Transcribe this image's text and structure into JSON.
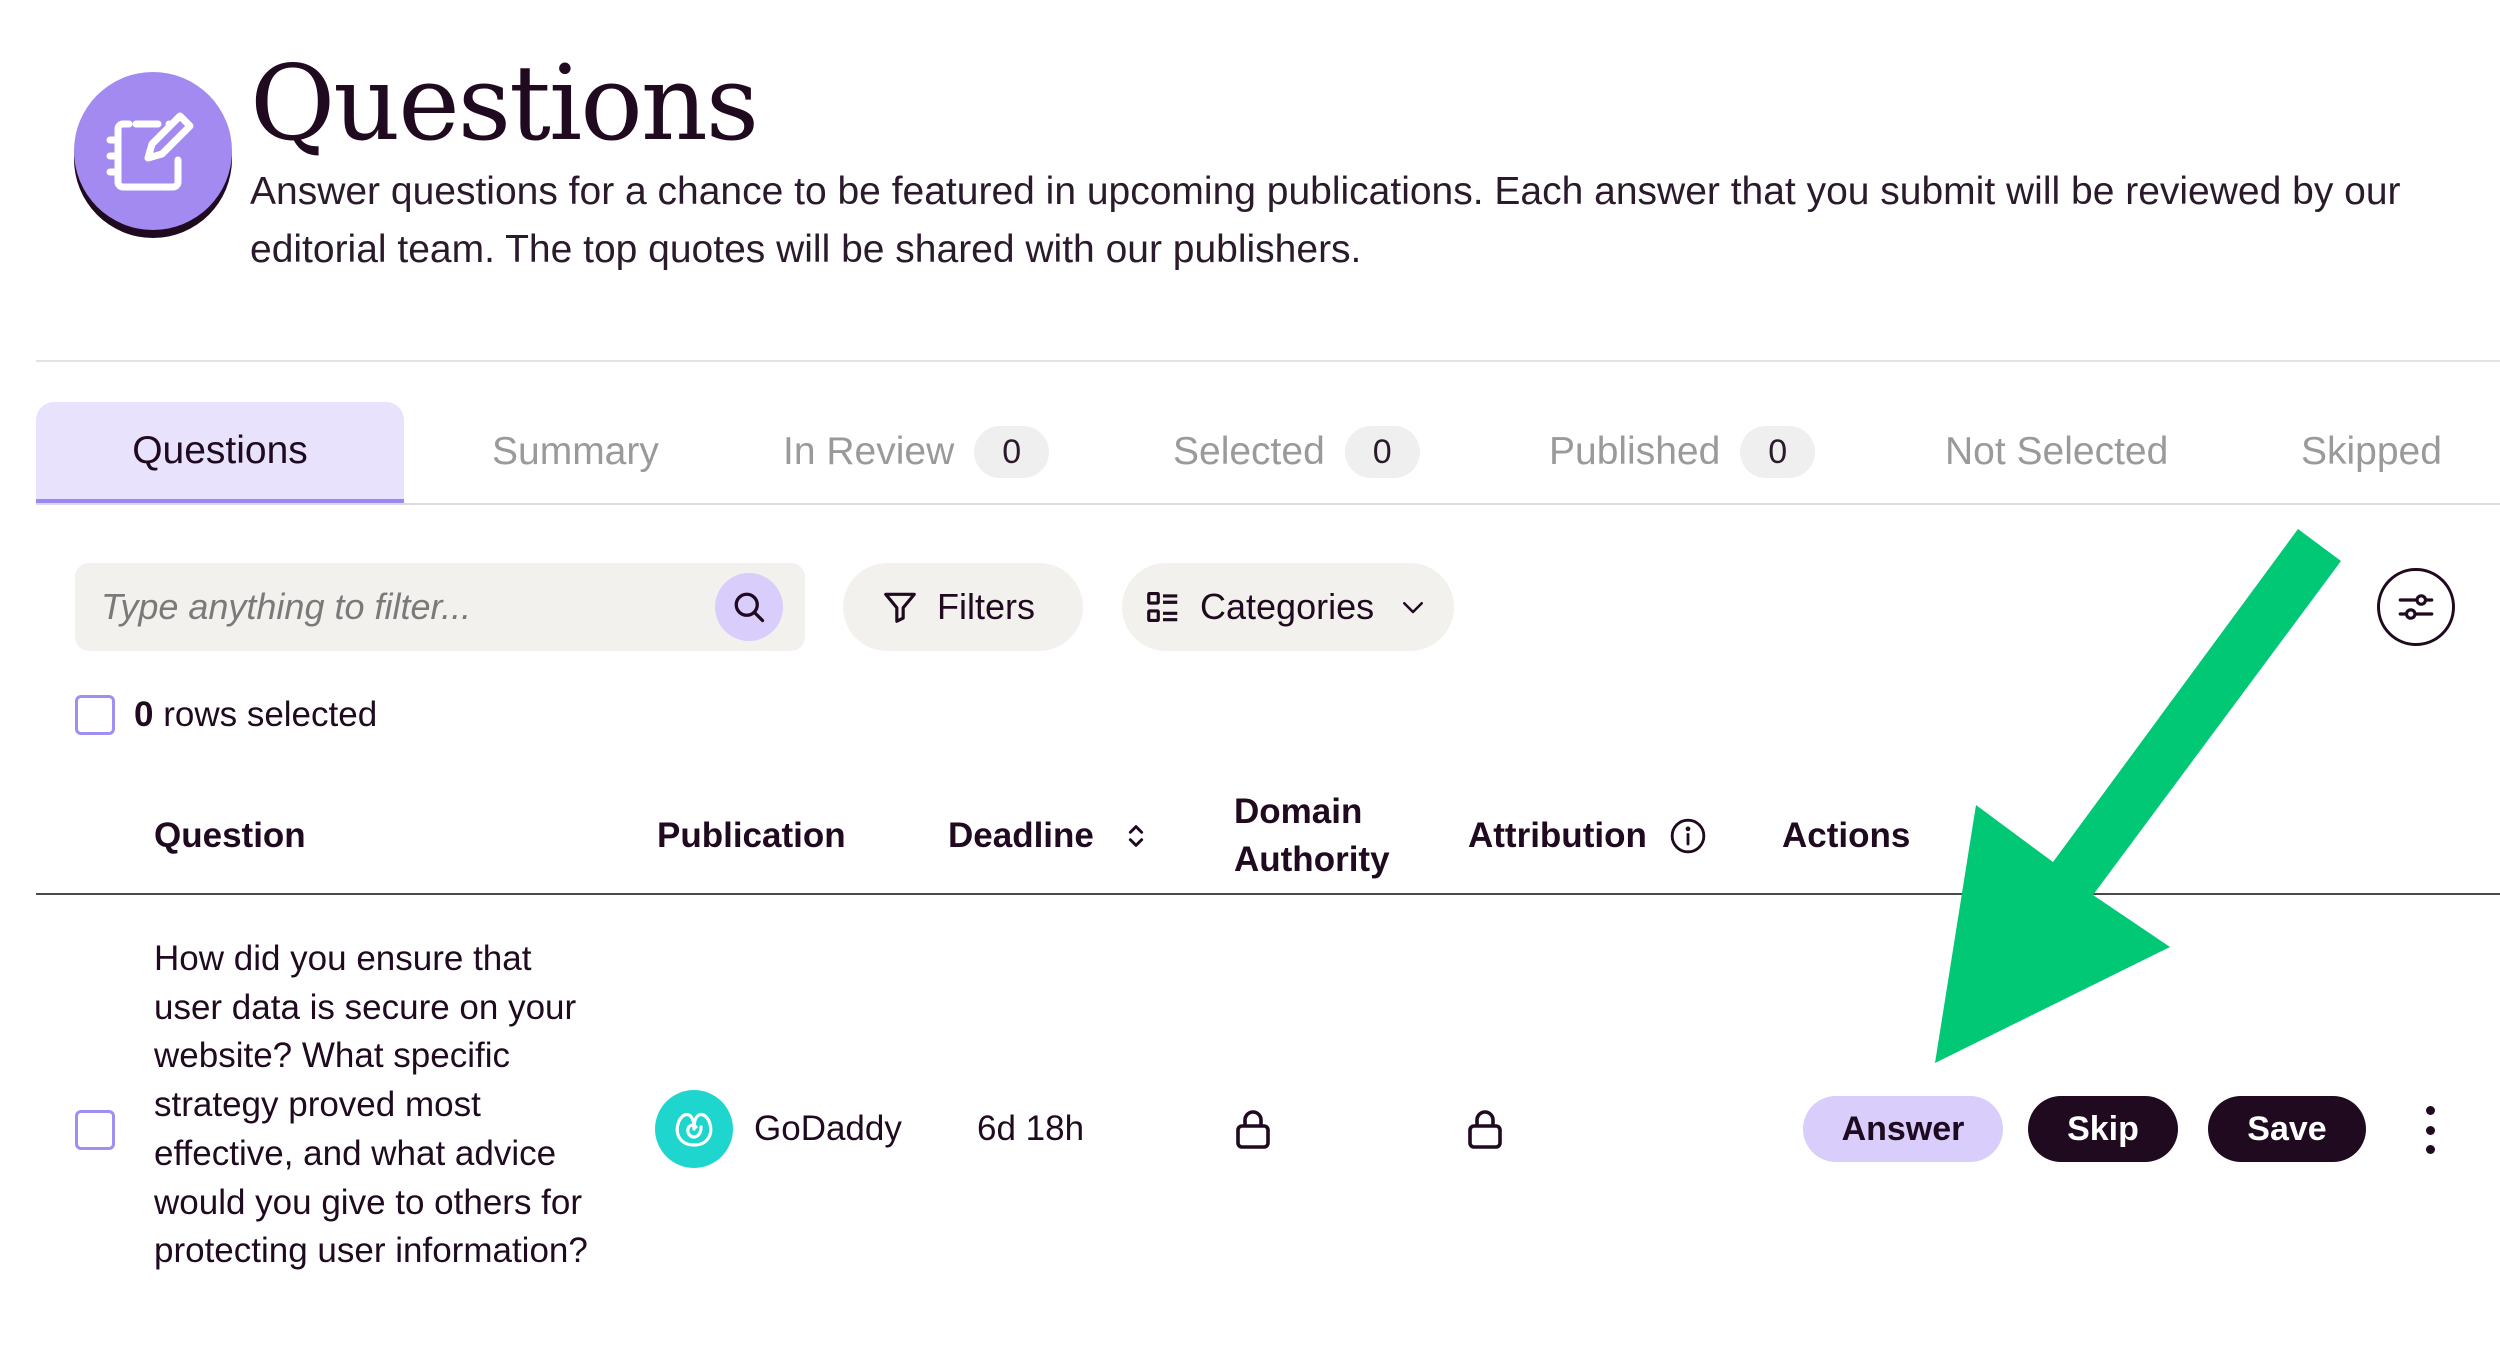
{
  "header": {
    "title": "Questions",
    "description": "Answer questions for a chance to be featured in upcoming publications. Each answer that you submit will be reviewed by our editorial  team. The top quotes will be shared with our publishers.",
    "icon": "notebook-pencil-icon"
  },
  "tabs": [
    {
      "label": "Questions",
      "active": true
    },
    {
      "label": "Summary"
    },
    {
      "label": "In Review",
      "count": "0"
    },
    {
      "label": "Selected",
      "count": "0"
    },
    {
      "label": "Published",
      "count": "0"
    },
    {
      "label": "Not Selected"
    },
    {
      "label": "Skipped"
    }
  ],
  "toolbar": {
    "search_placeholder": "Type anything to filter...",
    "filters_label": "Filters",
    "categories_label": "Categories"
  },
  "selection": {
    "count": "0",
    "label": " rows selected"
  },
  "table": {
    "columns": {
      "question": "Question",
      "publication": "Publication",
      "deadline": "Deadline",
      "domain_authority_1": "Domain",
      "domain_authority_2": "Authority",
      "attribution": "Attribution",
      "actions": "Actions"
    },
    "rows": [
      {
        "question": "How did you ensure that user data is secure on your website? What specific strategy proved most effective, and what advice would you give to others for protecting user information?",
        "publication": "GoDaddy",
        "deadline": "6d 18h",
        "domain_authority": "locked",
        "attribution": "locked",
        "actions": {
          "answer": "Answer",
          "skip": "Skip",
          "save": "Save"
        }
      }
    ]
  },
  "colors": {
    "accent_purple": "#a18ef3",
    "active_tab_bg": "#e8e2fc",
    "dark": "#1f0a1f",
    "publication_logo": "#1fd6cf",
    "annotation_arrow": "#00c875"
  }
}
